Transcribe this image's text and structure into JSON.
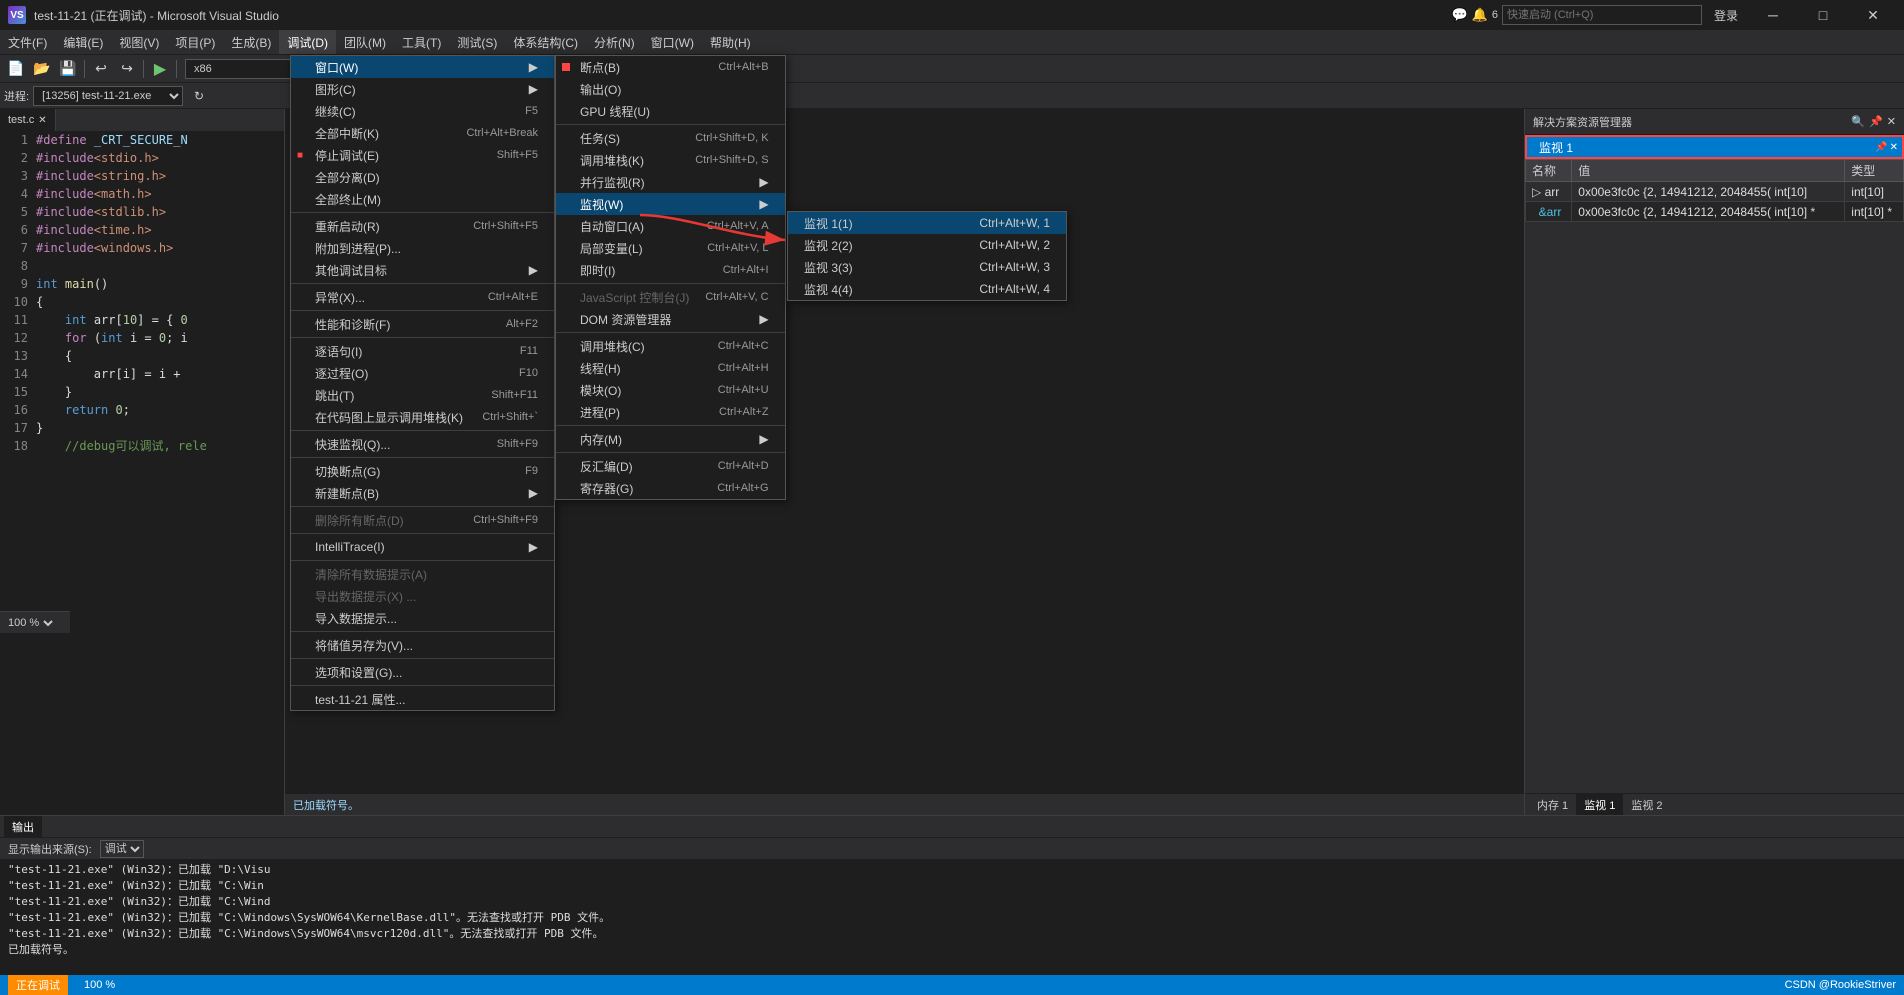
{
  "titleBar": {
    "title": "test-11-21 (正在调试) - Microsoft Visual Studio",
    "icon": "vs",
    "buttons": [
      "minimize",
      "maximize",
      "close"
    ]
  },
  "topRight": {
    "notifications": "6",
    "searchPlaceholder": "快速启动 (Ctrl+Q)",
    "login": "登录"
  },
  "menuBar": {
    "items": [
      {
        "label": "文件(F)"
      },
      {
        "label": "编辑(E)"
      },
      {
        "label": "视图(V)"
      },
      {
        "label": "项目(P)"
      },
      {
        "label": "生成(B)"
      },
      {
        "label": "调试(D)",
        "active": true
      },
      {
        "label": "团队(M)"
      },
      {
        "label": "工具(T)"
      },
      {
        "label": "测试(S)"
      },
      {
        "label": "体系结构(C)"
      },
      {
        "label": "分析(N)"
      },
      {
        "label": "窗口(W)"
      },
      {
        "label": "帮助(H)"
      }
    ]
  },
  "processBar": {
    "label": "进程:",
    "value": "[13256] test-11-21.exe"
  },
  "editorTab": {
    "filename": "test.c",
    "dirty": false
  },
  "projectName": "test-11-21",
  "codeLines": [
    {
      "num": "1",
      "text": "#define _CRT_SECURE_N"
    },
    {
      "num": "2",
      "text": "#include<stdio.h>"
    },
    {
      "num": "3",
      "text": "#include<string.h>"
    },
    {
      "num": "4",
      "text": "#include<math.h>"
    },
    {
      "num": "5",
      "text": "#include<stdlib.h>"
    },
    {
      "num": "6",
      "text": "#include<time.h>"
    },
    {
      "num": "7",
      "text": "#include<windows.h>"
    },
    {
      "num": "8",
      "text": ""
    },
    {
      "num": "9",
      "text": "int main()"
    },
    {
      "num": "10",
      "text": "{"
    },
    {
      "num": "11",
      "text": "    int arr[10] = { 0"
    },
    {
      "num": "12",
      "text": "    for (int i = 0; i"
    },
    {
      "num": "13",
      "text": "    {"
    },
    {
      "num": "14",
      "text": "        arr[i] = i +"
    },
    {
      "num": "15",
      "text": "    }"
    },
    {
      "num": "16",
      "text": "    return 0;"
    },
    {
      "num": "17",
      "text": "}"
    },
    {
      "num": "18",
      "text": "    //debug可以调试, rele"
    }
  ],
  "debugMenu": {
    "items": [
      {
        "label": "窗口(W)",
        "shortcut": "",
        "hasSubmenu": true,
        "active": true
      },
      {
        "label": "图形(C)",
        "shortcut": "",
        "hasSubmenu": true
      },
      {
        "label": "继续(C)",
        "shortcut": "F5"
      },
      {
        "label": "全部中断(K)",
        "shortcut": "Ctrl+Alt+Break"
      },
      {
        "label": "停止调试(E)",
        "shortcut": "Shift+F5"
      },
      {
        "label": "全部分离(D)",
        "shortcut": ""
      },
      {
        "label": "全部终止(M)",
        "shortcut": ""
      },
      {
        "sep": true
      },
      {
        "label": "重新启动(R)",
        "shortcut": "Ctrl+Shift+F5"
      },
      {
        "label": "附加到进程(P)...",
        "shortcut": ""
      },
      {
        "label": "其他调试目标",
        "shortcut": "",
        "hasSubmenu": true
      },
      {
        "sep": true
      },
      {
        "label": "异常(X)...",
        "shortcut": "Ctrl+Alt+E"
      },
      {
        "sep": true
      },
      {
        "label": "性能和诊断(F)",
        "shortcut": "Alt+F2"
      },
      {
        "sep": true
      },
      {
        "label": "逐语句(I)",
        "shortcut": "F11"
      },
      {
        "label": "逐过程(O)",
        "shortcut": "F10"
      },
      {
        "label": "跳出(T)",
        "shortcut": "Shift+F11"
      },
      {
        "label": "在代码图上显示调用堆栈(K)",
        "shortcut": "Ctrl+Shift+`"
      },
      {
        "sep": true
      },
      {
        "label": "快速监视(Q)...",
        "shortcut": "Shift+F9"
      },
      {
        "sep": true
      },
      {
        "label": "切换断点(G)",
        "shortcut": "F9"
      },
      {
        "label": "新建断点(B)",
        "shortcut": "",
        "hasSubmenu": true
      },
      {
        "sep": true
      },
      {
        "label": "删除所有断点(D)",
        "shortcut": "Ctrl+Shift+F9",
        "disabled": true
      },
      {
        "sep": true
      },
      {
        "label": "IntelliTrace(I)",
        "shortcut": "",
        "hasSubmenu": true
      },
      {
        "sep": true
      },
      {
        "label": "清除所有数据提示(A)",
        "disabled": true
      },
      {
        "label": "导出数据提示(X) ...",
        "disabled": true
      },
      {
        "label": "导入数据提示...",
        "disabled": false
      },
      {
        "sep": true
      },
      {
        "label": "将储值另存为(V)...",
        "disabled": false
      },
      {
        "sep": true
      },
      {
        "label": "选项和设置(G)...",
        "disabled": false
      },
      {
        "sep": true
      },
      {
        "label": "test-11-21 属性...",
        "disabled": false
      }
    ]
  },
  "windowSubmenu": {
    "items": [
      {
        "label": "断点(B)",
        "shortcut": "Ctrl+Alt+B",
        "icon": "breakpoint"
      },
      {
        "label": "输出(O)",
        "shortcut": ""
      },
      {
        "label": "GPU 线程(U)",
        "shortcut": ""
      },
      {
        "sep": true
      },
      {
        "label": "任务(S)",
        "shortcut": "Ctrl+Shift+D, K"
      },
      {
        "label": "调用堆栈(K)",
        "shortcut": "Ctrl+Shift+D, S"
      },
      {
        "label": "并行监视(R)",
        "shortcut": "",
        "hasSubmenu": true
      },
      {
        "label": "监视(W)",
        "shortcut": "",
        "hasSubmenu": true,
        "active": true
      },
      {
        "label": "自动窗口(A)",
        "shortcut": "Ctrl+Alt+V, A"
      },
      {
        "label": "局部变量(L)",
        "shortcut": "Ctrl+Alt+V, L"
      },
      {
        "label": "即时(I)",
        "shortcut": "Ctrl+Alt+I"
      },
      {
        "sep": true
      },
      {
        "label": "JavaScript 控制台(J)",
        "shortcut": "Ctrl+Alt+V, C",
        "disabled": true
      },
      {
        "label": "DOM 资源管理器",
        "shortcut": "",
        "hasSubmenu": true
      },
      {
        "sep": true
      },
      {
        "label": "调用堆栈(C)",
        "shortcut": "Ctrl+Alt+C"
      },
      {
        "label": "线程(H)",
        "shortcut": "Ctrl+Alt+H"
      },
      {
        "label": "模块(O)",
        "shortcut": "Ctrl+Alt+U"
      },
      {
        "label": "进程(P)",
        "shortcut": "Ctrl+Alt+Z"
      },
      {
        "sep": true
      },
      {
        "label": "内存(M)",
        "shortcut": "",
        "hasSubmenu": true
      },
      {
        "sep": true
      },
      {
        "label": "反汇编(D)",
        "shortcut": "Ctrl+Alt+D"
      },
      {
        "label": "寄存器(G)",
        "shortcut": "Ctrl+Alt+G"
      }
    ]
  },
  "watchSubmenu": {
    "items": [
      {
        "label": "监视 1(1)",
        "shortcut": "Ctrl+Alt+W, 1",
        "highlighted": true
      },
      {
        "label": "监视 2(2)",
        "shortcut": "Ctrl+Alt+W, 2"
      },
      {
        "label": "监视 3(3)",
        "shortcut": "Ctrl+Alt+W, 3"
      },
      {
        "label": "监视 4(4)",
        "shortcut": "Ctrl+Alt+W, 4"
      }
    ]
  },
  "watchPanel": {
    "title": "监视 1",
    "columns": [
      "名称",
      "值",
      "类型"
    ],
    "rows": [
      {
        "name": "▷ arr",
        "value": "0x00e3fc0c {2, 14941212, 2048455( int[10]",
        "type": "int[10]"
      },
      {
        "name": "  &arr",
        "value": "0x00e3fc0c {2, 14941212, 2048455( int[10] *",
        "type": "int[10] *"
      }
    ]
  },
  "solutionExplorer": {
    "title": "解决方案资源管理器"
  },
  "outputPanel": {
    "label": "显示输出来源(S):",
    "source": "调试",
    "lines": [
      "\"test-11-21.exe\" (Win32)：已加载 \"D:\\Visu",
      "\"test-11-21.exe\" (Win32)：已加载 \"C:\\Win",
      "\"test-11-21.exe\" (Win32)：已加载 \"C:\\Wind",
      "\"test-11-21.exe\" (Win32)：已加载 \"C:\\Windows\\SysWOW64\\KernelBase.dll\"。无法查找或打开 PDB 文件。",
      "\"test-11-21.exe\" (Win32)：已加载 \"C:\\Windows\\SysWOW64\\msvcr120d.dll\"。无法查找或打开 PDB 文件。",
      "已加载符号。"
    ]
  },
  "watchTabs": {
    "tabs": [
      "内存 1",
      "监视 1",
      "监视 2"
    ]
  },
  "statusBar": {
    "zoom": "100 %",
    "branding": "CSDN @RookieStriver"
  }
}
